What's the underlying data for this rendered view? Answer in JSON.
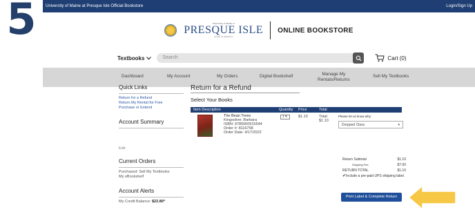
{
  "step_number": "5",
  "topbar": {
    "site_title": "University of Maine at Presque Isle Official Bookstore",
    "login": "Login/Sign Up"
  },
  "logo": {
    "small_line": "University of Maine at",
    "big_line": "PRESQUE ISLE",
    "tag_line": "worlds of Ambiance",
    "bookstore": "ONLINE BOOKSTORE"
  },
  "search": {
    "category": "Textbooks",
    "placeholder": "Search",
    "cart_label": "Cart (0)"
  },
  "nav": {
    "items": [
      "Dashboard",
      "My Account",
      "My Orders",
      "Digital Bookshelf",
      "Manage My",
      "Rentals/Returns",
      "Sell My Textbooks"
    ]
  },
  "sidebar": {
    "quick_links_title": "Quick Links",
    "quick_links": [
      "Return for a Refund",
      "Return My Rental for Free",
      "Purchase or Extend"
    ],
    "account_summary_title": "Account Summary",
    "edit_label": "Edit",
    "current_orders_title": "Current Orders",
    "current_orders": [
      "Purchased: Sell My Textbooks",
      "My eBookshelf"
    ],
    "account_alerts_title": "Account Alerts",
    "credit_label": "My Credit Balance:",
    "credit_value": "$22.80*"
  },
  "main": {
    "title": "Return for a Refund",
    "subtitle": "Select Your Books",
    "columns": [
      "Item Description",
      "Quantity",
      "Price",
      "Total"
    ],
    "book": {
      "title": "The Bean Trees",
      "author": "Kingsolver, Barbara",
      "isbn": "ISBN: 9780060915544",
      "order": "Order #: 8116758",
      "order_date": "Order Date: 4/17/2022",
      "qty": "1",
      "price": "$1.10",
      "total_label": "Total:",
      "total": "$1.10",
      "reason_prompt": "Please let us know why:",
      "reason_value": "Dropped Class"
    }
  },
  "summary": {
    "subtotal_label": "Return Subtotal",
    "subtotal": "$1.10",
    "shipping_label": "Shipping Fee",
    "shipping": "$7.00",
    "total_label": "RETURN TOTAL",
    "total": "$1.10",
    "checkbox_label": "Include a pre-paid UPS shipping label.",
    "button": "Print Label & Complete Return"
  },
  "colors": {
    "navy": "#1f3f74",
    "button_blue": "#1f4f9a",
    "arrow": "#f6c845",
    "nav_gray": "#d6d6d6"
  }
}
